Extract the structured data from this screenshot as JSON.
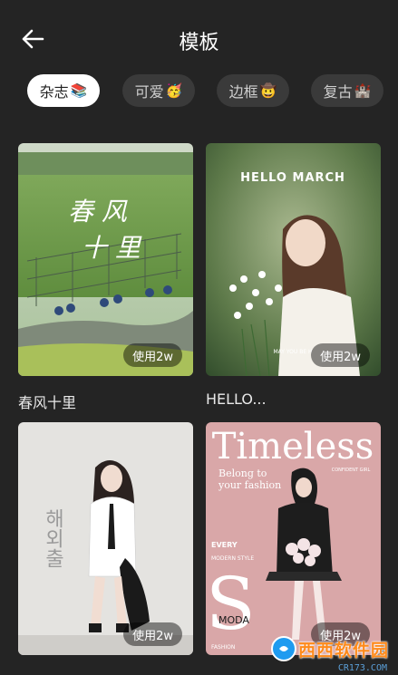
{
  "header": {
    "title": "模板"
  },
  "chips": [
    {
      "label": "杂志",
      "emoji": "📚",
      "active": true
    },
    {
      "label": "可爱",
      "emoji": "🥳",
      "active": false
    },
    {
      "label": "边框",
      "emoji": "🤠",
      "active": false
    },
    {
      "label": "复古",
      "emoji": "🏰",
      "active": false
    }
  ],
  "templates": [
    {
      "name": "春风十里",
      "usage": "使用2w",
      "poster_text": "春风十里"
    },
    {
      "name": "HELLO...",
      "usage": "使用2w",
      "poster_text": "HELLO MARCH",
      "poster_sub": "MAY YOU BE H"
    },
    {
      "name": "",
      "usage": "使用2w",
      "poster_text": "해외출"
    },
    {
      "name": "",
      "usage": "使用2w",
      "poster_text": "Timeless",
      "poster_sub": "Belong to your fashion",
      "poster_extra": [
        "EVERY",
        "MODERN STYLE",
        "MODA",
        "CONFIDENT GIRL",
        "FASHION"
      ]
    }
  ],
  "watermark": {
    "text": "西西软件园",
    "url": "CR173.COM"
  },
  "icons": {
    "back": "arrow-left-icon"
  }
}
